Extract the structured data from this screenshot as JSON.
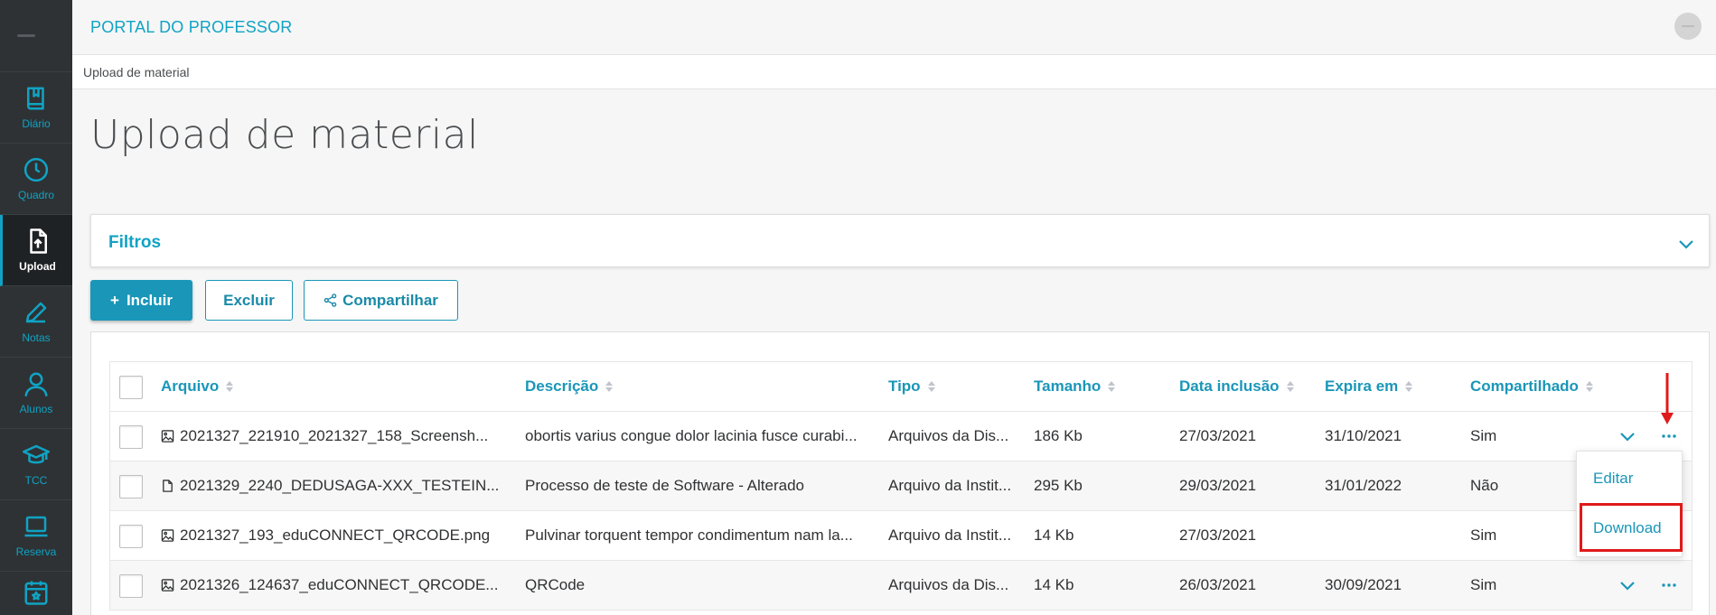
{
  "app": {
    "title": "PORTAL DO PROFESSOR"
  },
  "breadcrumb": "Upload de material",
  "page_title": "Upload de material",
  "sidebar": {
    "items": [
      {
        "label": "Diário",
        "icon": "book-icon",
        "active": false
      },
      {
        "label": "Quadro",
        "icon": "clock-icon",
        "active": false
      },
      {
        "label": "Upload",
        "icon": "file-upload-icon",
        "active": true
      },
      {
        "label": "Notas",
        "icon": "pencil-icon",
        "active": false
      },
      {
        "label": "Alunos",
        "icon": "person-icon",
        "active": false
      },
      {
        "label": "TCC",
        "icon": "graduation-cap-icon",
        "active": false
      },
      {
        "label": "Reserva",
        "icon": "laptop-icon",
        "active": false
      },
      {
        "label": "",
        "icon": "calendar-icon",
        "active": false
      }
    ]
  },
  "filters": {
    "title": "Filtros"
  },
  "toolbar": {
    "include_label": "Incluir",
    "include_prefix": "+",
    "delete_label": "Excluir",
    "share_label": "Compartilhar"
  },
  "table": {
    "columns": [
      "Arquivo",
      "Descrição",
      "Tipo",
      "Tamanho",
      "Data inclusão",
      "Expira em",
      "Compartilhado"
    ],
    "rows": [
      {
        "file_icon": "image-icon",
        "arquivo": "2021327_221910_2021327_158_Screensh...",
        "descricao": "obortis varius congue dolor lacinia fusce curabi...",
        "tipo": "Arquivos da Dis...",
        "tamanho": "186 Kb",
        "data_inclusao": "27/03/2021",
        "expira_em": "31/10/2021",
        "compartilhado": "Sim",
        "has_actions": true
      },
      {
        "file_icon": "document-icon",
        "arquivo": "2021329_2240_DEDUSAGA-XXX_TESTEIN...",
        "descricao": "Processo de teste de Software - Alterado",
        "tipo": "Arquivo da Instit...",
        "tamanho": "295 Kb",
        "data_inclusao": "29/03/2021",
        "expira_em": "31/01/2022",
        "compartilhado": "Não",
        "has_actions": false
      },
      {
        "file_icon": "image-icon",
        "arquivo": "2021327_193_eduCONNECT_QRCODE.png",
        "descricao": "Pulvinar torquent tempor condimentum nam la...",
        "tipo": "Arquivo da Instit...",
        "tamanho": "14 Kb",
        "data_inclusao": "27/03/2021",
        "expira_em": "",
        "compartilhado": "Sim",
        "has_actions": false
      },
      {
        "file_icon": "image-icon",
        "arquivo": "2021326_124637_eduCONNECT_QRCODE...",
        "descricao": "QRCode",
        "tipo": "Arquivos da Dis...",
        "tamanho": "14 Kb",
        "data_inclusao": "26/03/2021",
        "expira_em": "30/09/2021",
        "compartilhado": "Sim",
        "has_actions": true
      }
    ]
  },
  "row_menu": {
    "edit_label": "Editar",
    "download_label": "Download"
  },
  "colors": {
    "accent": "#10a3c4",
    "sidebar_bg": "#2e3234",
    "highlight": "#e01a1a"
  }
}
